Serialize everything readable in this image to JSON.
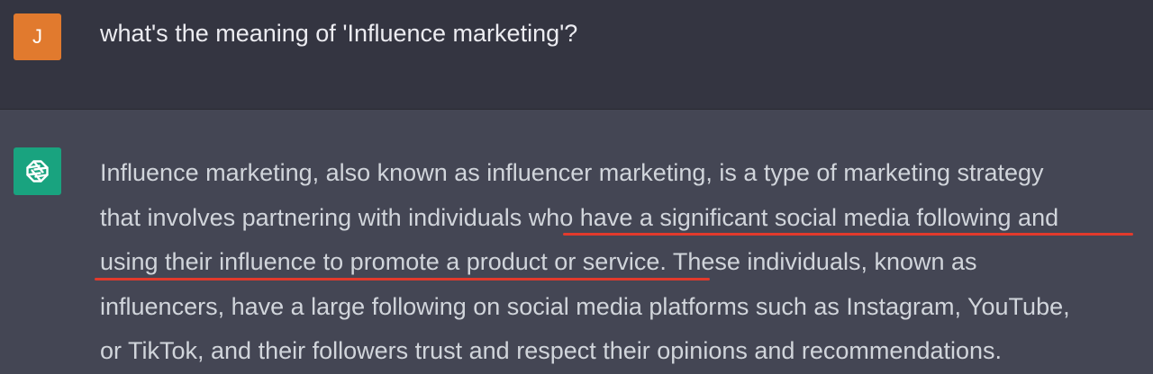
{
  "user_message": {
    "avatar_initial": "J",
    "avatar_color": "#e17a2e",
    "text": "what's the meaning of 'Influence marketing'?"
  },
  "assistant_message": {
    "avatar_icon": "openai-logo-icon",
    "avatar_color": "#19a37f",
    "lines": [
      "Influence marketing, also known as influencer marketing, is a type of marketing strategy",
      "that involves partnering with individuals who have a significant social media following and",
      "using their influence to promote a product or service. These individuals, known as",
      "influencers, have a large following on social media platforms such as Instagram, YouTube,",
      "or TikTok, and their followers trust and respect their opinions and recommendations."
    ],
    "highlight_color": "#e23a2c"
  }
}
